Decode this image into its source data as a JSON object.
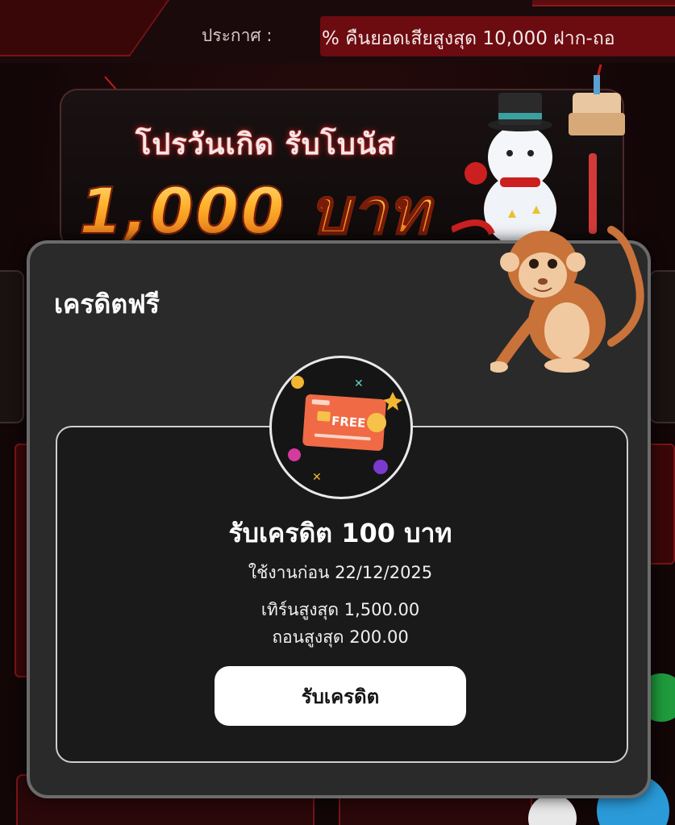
{
  "announcement": {
    "label": "ประกาศ :",
    "marquee_text": "% คืนยอดเสียสูงสุด 10,000 ฝาก-ถอ"
  },
  "banner": {
    "subtitle": "โปรวันเกิด รับโบนัส",
    "amount": "1,000 บาท"
  },
  "modal": {
    "title": "เครดิตฟรี",
    "card_icon_text": "FREE",
    "credit_title": "รับเครดิต 100 บาท",
    "expiry": "ใช้งานก่อน 22/12/2025",
    "max_turnover": "เทิร์นสูงสุด 1,500.00",
    "max_withdraw": "ถอนสูงสุด 200.00",
    "claim_button": "รับเครดิต"
  },
  "colors": {
    "accent_red": "#6c0b10",
    "button_bg": "#ffffff",
    "modal_bg": "#2a2a2a"
  }
}
